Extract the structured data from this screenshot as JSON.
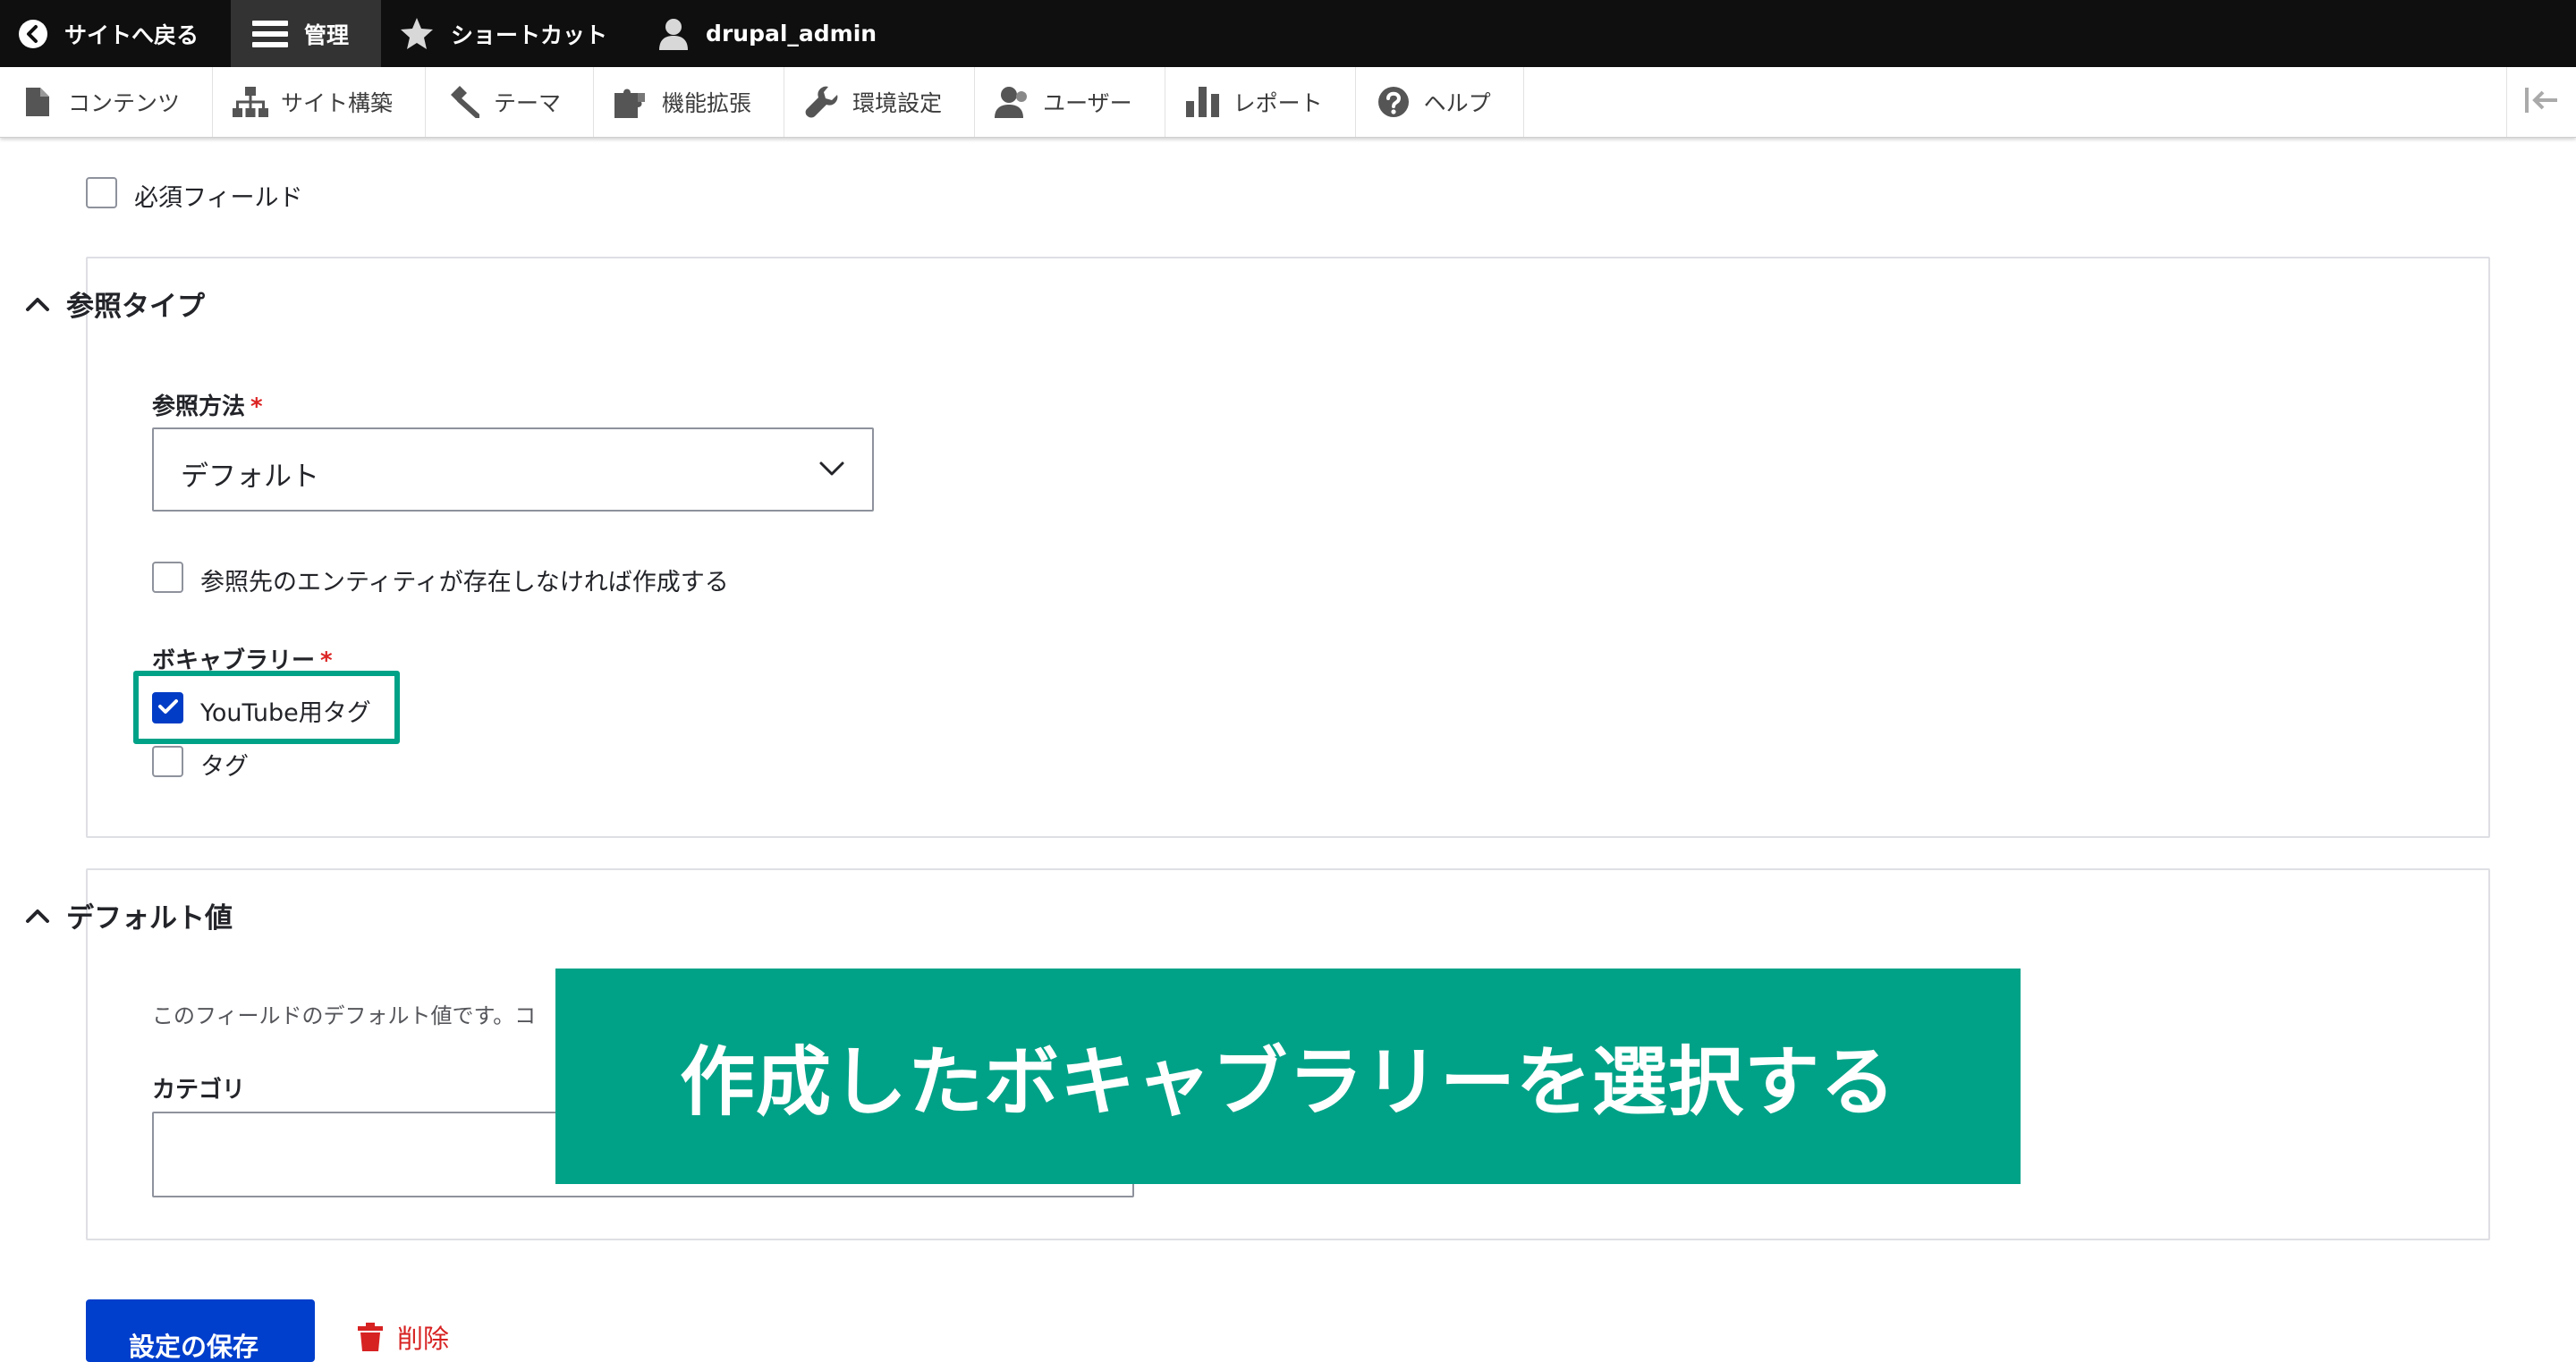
{
  "topbar": {
    "back_to_site": "サイトへ戻る",
    "manage": "管理",
    "shortcuts": "ショートカット",
    "user": "drupal_admin"
  },
  "tray": {
    "items": [
      "コンテンツ",
      "サイト構築",
      "テーマ",
      "機能拡張",
      "環境設定",
      "ユーザー",
      "レポート",
      "ヘルプ"
    ]
  },
  "form": {
    "required_field_label": "必須フィールド",
    "reference_type": {
      "legend": "参照タイプ",
      "method_label": "参照方法",
      "required_mark": "*",
      "method_value": "デフォルト",
      "auto_create_label": "参照先のエンティティが存在しなければ作成する",
      "vocabulary_label": "ボキャブラリー",
      "vocabularies": [
        {
          "label": "YouTube用タグ",
          "checked": true
        },
        {
          "label": "タグ",
          "checked": false
        }
      ]
    },
    "default_value": {
      "legend": "デフォルト値",
      "description": "このフィールドのデフォルト値です。コ",
      "category_label": "カテゴリ",
      "category_value": ""
    },
    "save_button": "設定の保存",
    "delete_link": "削除"
  },
  "annotation": {
    "banner_text": "作成したボキャブラリーを選択する"
  },
  "colors": {
    "accent_teal": "#00a287",
    "primary_blue": "#003ecc",
    "danger_red": "#d72222",
    "toolbar_black": "#0f0f0f"
  },
  "icons": [
    "back-icon",
    "menu-icon",
    "star-icon",
    "user-icon",
    "file-icon",
    "sitemap-icon",
    "paintbrush-icon",
    "puzzle-icon",
    "wrench-icon",
    "people-icon",
    "bar-chart-icon",
    "help-icon",
    "collapse-icon",
    "chevron-up-icon",
    "chevron-down-icon",
    "check-icon",
    "trash-icon"
  ]
}
